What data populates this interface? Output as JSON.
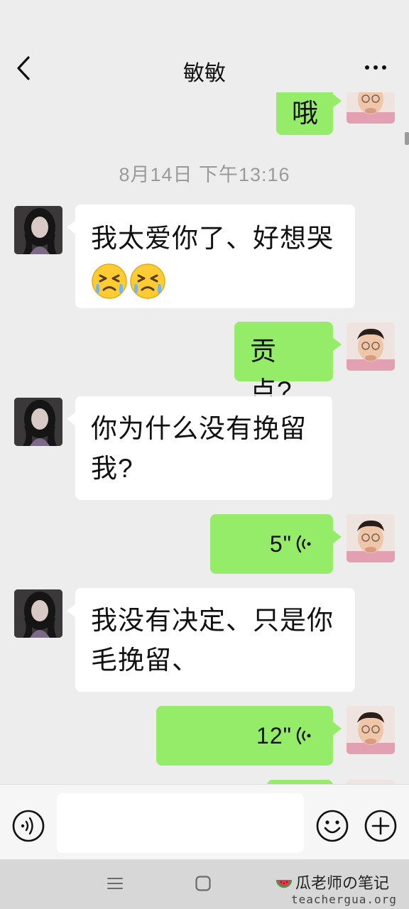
{
  "header": {
    "title": "敏敏",
    "back_icon": "chevron-left-icon",
    "more_icon": "more-horizontal-icon"
  },
  "messages": {
    "m0_text": "哦",
    "timestamp": "8月14日 下午13:16",
    "m1_text": "我太爱你了、好想哭",
    "m1_emojis": [
      "persevering-face-emoji",
      "persevering-face-emoji"
    ],
    "m2_text": "贡点?",
    "m3_line1": "你为什么没有挽留",
    "m3_line2": "我?",
    "m4_duration": "5\"",
    "m5_line1": "我没有决定、只是你",
    "m5_line2": "毛挽留、",
    "m6_duration": "12\""
  },
  "input_bar": {
    "voice_icon": "voice-input-icon",
    "input_value": "",
    "emoji_icon": "emoji-icon",
    "plus_icon": "plus-circle-icon"
  },
  "system_nav": {
    "menu_icon": "menu-icon",
    "home_icon": "home-square-icon"
  },
  "watermark": {
    "text": "瓜老师の笔记",
    "url": "teachergua.org"
  },
  "colors": {
    "background": "#ededed",
    "sent_bubble": "#95ec69",
    "received_bubble": "#ffffff",
    "timestamp": "#9a9a9a"
  }
}
